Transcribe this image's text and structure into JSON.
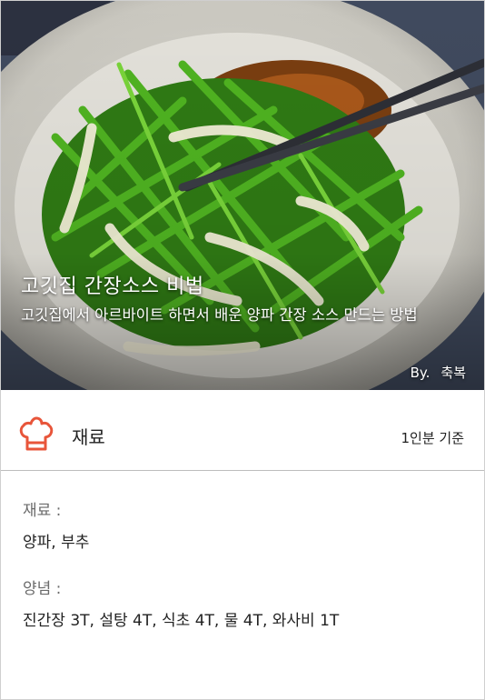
{
  "hero": {
    "title": "고깃집 간장소스 비법",
    "description": "고깃집에서 아르바이트 하면서 배운 양파 간장 소스 만드는 방법",
    "author_prefix": "By.",
    "author_name": "축복"
  },
  "ingredients": {
    "icon": "chef-hat-icon",
    "title": "재료",
    "serving": "1인분 기준",
    "sections": [
      {
        "label": "재료 :",
        "value": "양파, 부추"
      },
      {
        "label": "양념 :",
        "value": "진간장 3T, 설탕 4T, 식초 4T, 물 4T, 와사비 1T"
      }
    ]
  },
  "colors": {
    "accent": "#e8553a",
    "divider": "#bdbdbd"
  }
}
